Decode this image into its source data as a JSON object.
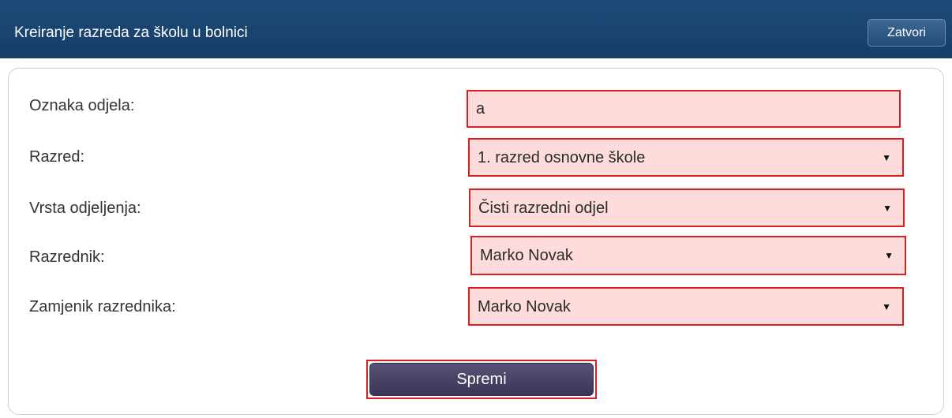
{
  "dialog": {
    "title": "Kreiranje razreda za školu u bolnici",
    "close_label": "Zatvori"
  },
  "form": {
    "fields": [
      {
        "label": "Oznaka odjela:",
        "value": "a",
        "type": "text"
      },
      {
        "label": "Razred:",
        "value": "1. razred osnovne škole",
        "type": "select"
      },
      {
        "label": "Vrsta odjeljenja:",
        "value": "Čisti razredni odjel",
        "type": "select"
      },
      {
        "label": "Razrednik:",
        "value": "Marko Novak",
        "type": "select"
      },
      {
        "label": "Zamjenik razrednika:",
        "value": "Marko Novak",
        "type": "select"
      }
    ],
    "save_label": "Spremi"
  },
  "colors": {
    "titlebar": "#1e4a78",
    "highlight_border": "#dd1e1e",
    "highlight_fill": "#ffdcdc",
    "save_button": "#4a4366"
  },
  "icons": {
    "dropdown": "caret-down-icon"
  }
}
